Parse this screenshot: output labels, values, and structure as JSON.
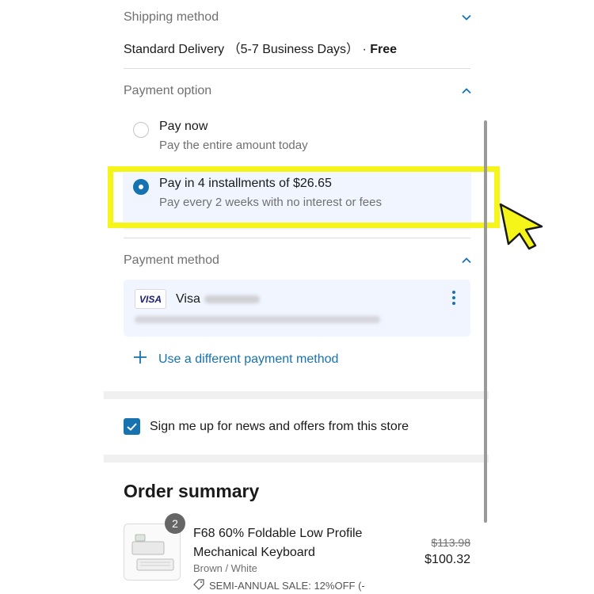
{
  "shipping": {
    "title": "Shipping method",
    "method": "Standard Delivery （5-7 Business Days）",
    "separator": " · ",
    "price": "Free"
  },
  "payment_option": {
    "title": "Payment option",
    "options": [
      {
        "title": "Pay now",
        "subtitle": "Pay the entire amount today",
        "selected": false
      },
      {
        "title": "Pay in 4 installments of $26.65",
        "subtitle": "Pay every 2 weeks with no interest or fees",
        "selected": true
      }
    ]
  },
  "payment_method": {
    "title": "Payment method",
    "card_badge": "VISA",
    "card_brand": "Visa",
    "add_label": "Use a different payment method"
  },
  "newsletter": {
    "label": "Sign me up for news and offers from this store",
    "checked": true
  },
  "summary": {
    "title": "Order summary",
    "item": {
      "quantity": "2",
      "name": "F68 60% Foldable Low Profile Mechanical Keyboard",
      "variant": "Brown / White",
      "discount": "SEMI-ANNUAL SALE: 12%OFF (-",
      "original_price": "$113.98",
      "price": "$100.32"
    }
  },
  "colors": {
    "accent": "#1773b0",
    "highlight": "#f5f51a",
    "selected_bg": "#f0f5ff"
  }
}
